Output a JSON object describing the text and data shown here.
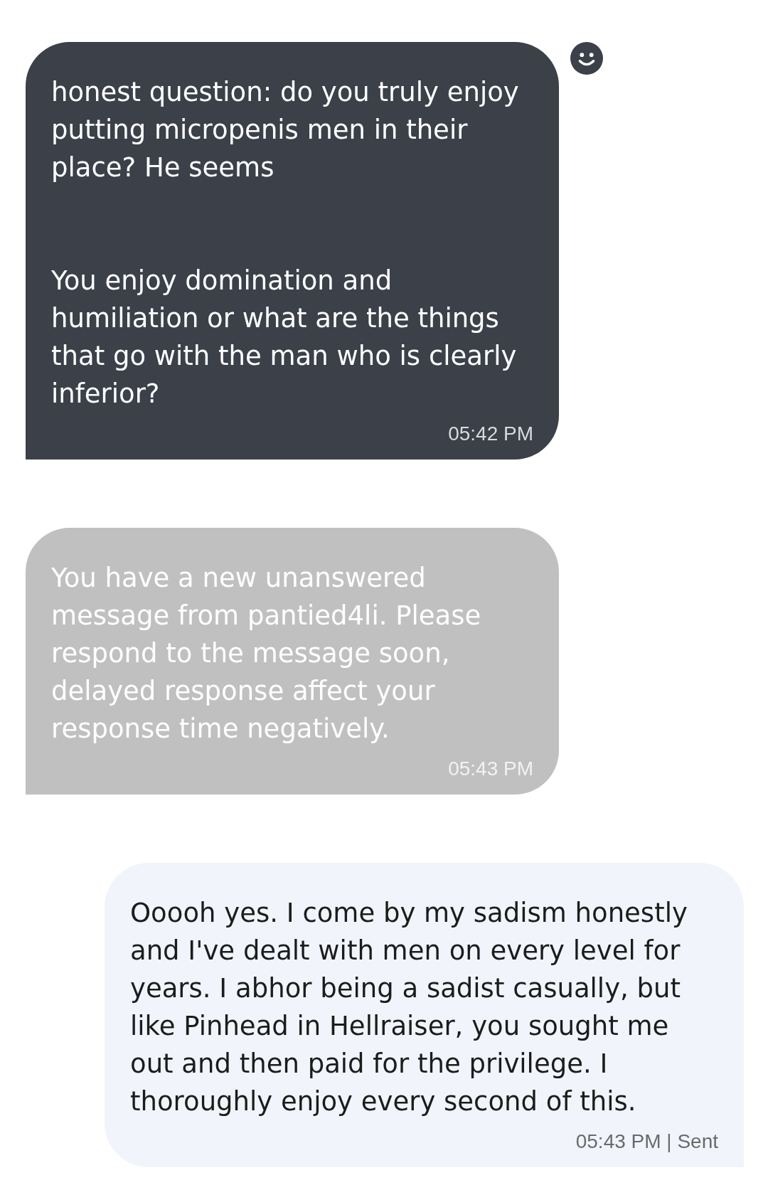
{
  "messages": [
    {
      "kind": "received",
      "text": "honest question: do you truly enjoy putting micropenis men in their place? He seems\n\n\nYou enjoy domination and humiliation or what are the things that go with the man who is clearly inferior?",
      "time": "05:42 PM",
      "reaction_button": true
    },
    {
      "kind": "system",
      "text": "You have a new unanswered message from pantied4li. Please respond to the message soon, delayed response affect your response time negatively.",
      "time": "05:43 PM",
      "reaction_button": false
    },
    {
      "kind": "sent",
      "text": "Ooooh yes. I come by my sadism honestly and I've dealt with men on every level for years. I abhor being a sadist casually, but like Pinhead in Hellraiser, you sought me out and then paid for the privilege. I thoroughly enjoy every second of this.",
      "time": "05:43 PM | Sent",
      "reaction_button": false
    }
  ]
}
